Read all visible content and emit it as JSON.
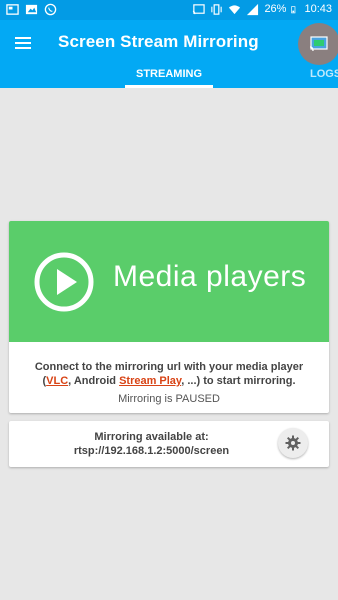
{
  "status_bar": {
    "battery": "26%",
    "time": "10:43",
    "left_icons": [
      "gallery-icon",
      "image-icon",
      "whatsapp-icon"
    ],
    "right_icons": [
      "cast-status-icon",
      "vibrate-icon",
      "wifi-icon",
      "signal-icon",
      "battery-icon"
    ]
  },
  "app_bar": {
    "title": "Screen Stream Mirroring",
    "menu_icon": "menu-icon",
    "cast_icon": "cast-icon"
  },
  "tabs": {
    "streaming": "STREAMING",
    "logs": "LOGS"
  },
  "media_card": {
    "title": "Media players",
    "connect_prefix": "Connect to the mirroring url with your media player (",
    "link_vlc": "VLC",
    "connect_mid": ", Android ",
    "link_streamplay": "Stream Play",
    "connect_suffix": ", ...) to start mirroring.",
    "status": "Mirroring is PAUSED"
  },
  "address_card": {
    "label": "Mirroring available at:",
    "url": "rtsp://192.168.1.2:5000/screen",
    "settings_icon": "gear-icon"
  },
  "colors": {
    "status_bar": "#039be5",
    "app_bar": "#03a9f4",
    "media_green": "#5acd6a",
    "link": "#d84315",
    "background": "#e7e7e7"
  }
}
